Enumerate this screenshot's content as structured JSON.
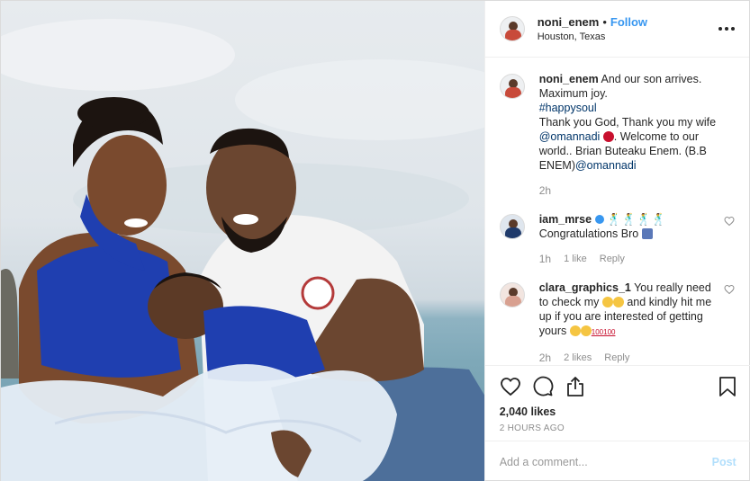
{
  "post": {
    "username": "noni_enem",
    "separator": "•",
    "follow_label": "Follow",
    "location": "Houston, Texas"
  },
  "caption": {
    "username": "noni_enem",
    "line1": "And our son arrives. Maximum joy.",
    "hashtag": "#happysoul",
    "line2": "Thank you God, Thank you my wife",
    "mention1": "@omannadi",
    "line3": ". Welcome to our world.. Brian Buteaku Enem. (B.B ENEM)",
    "mention2": "@omannadi",
    "time": "2h"
  },
  "comments": [
    {
      "username": "iam_mrse",
      "text": "Congratulations Bro",
      "time": "1h",
      "likes": "1 like",
      "reply": "Reply"
    },
    {
      "username": "clara_graphics_1",
      "text_a": "You really need to check my",
      "text_b": "and kindly hit me up if you are interested of getting yours",
      "hundred": "100100",
      "time": "2h",
      "likes": "2 likes",
      "reply": "Reply"
    }
  ],
  "stats": {
    "likes": "2,040 likes",
    "ago": "2 HOURS AGO"
  },
  "add_comment": {
    "placeholder": "Add a comment...",
    "post_label": "Post"
  },
  "icons": [
    "more-options-icon",
    "verified-icon",
    "heart-icon",
    "comment-icon",
    "share-icon",
    "bookmark-icon"
  ],
  "colors": {
    "link": "#3897f0",
    "mention": "#003569",
    "muted": "#8e8e8e",
    "post_disabled": "#b2dffc"
  }
}
